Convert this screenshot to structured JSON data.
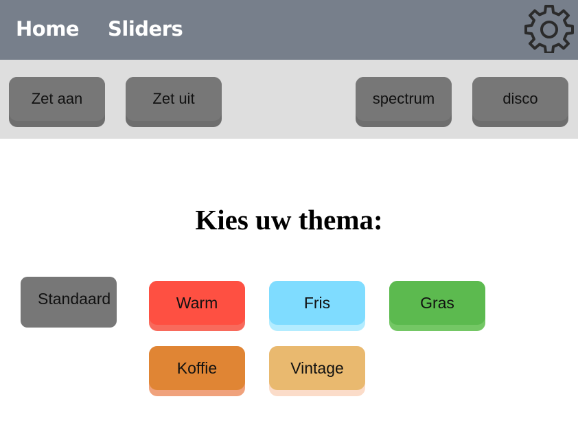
{
  "nav": {
    "home_label": "Home",
    "sliders_label": "Sliders",
    "settings_icon": "gear-icon"
  },
  "toolbar": {
    "on_label": "Zet aan",
    "off_label": "Zet uit",
    "spectrum_label": "spectrum",
    "disco_label": "disco"
  },
  "main": {
    "heading": "Kies uw thema:",
    "themes": {
      "standaard": "Standaard",
      "warm": "Warm",
      "fris": "Fris",
      "gras": "Gras",
      "koffie": "Koffie",
      "vintage": "Vintage"
    }
  },
  "colors": {
    "navbar": "#777f8b",
    "toolbar": "#dedede",
    "button_gray": "#777777",
    "warm": "#fe5042",
    "fris": "#7fdcff",
    "gras": "#5cba4f",
    "koffie": "#e08534",
    "vintage": "#e9b96f"
  }
}
